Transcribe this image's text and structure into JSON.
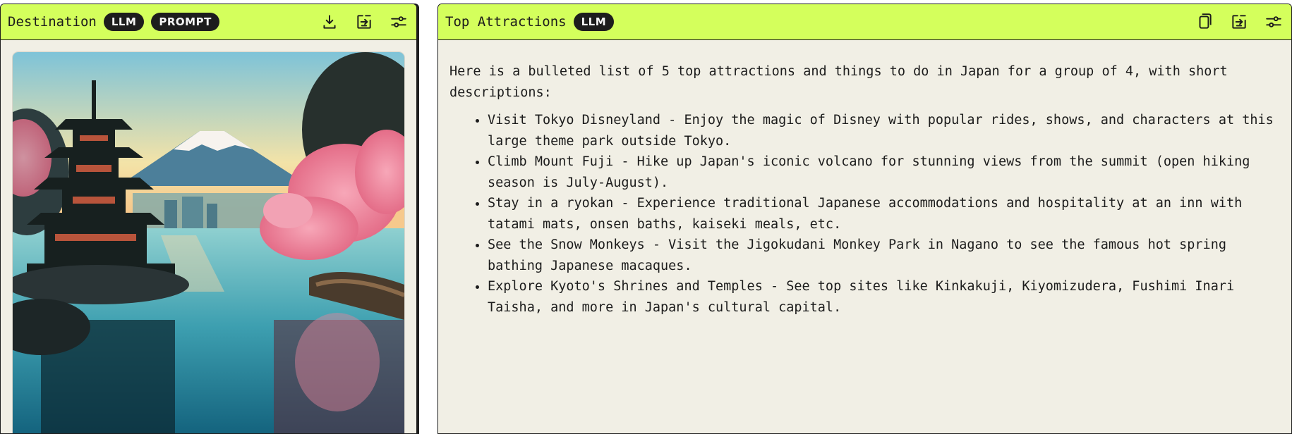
{
  "left_panel": {
    "title": "Destination",
    "badges": [
      "LLM",
      "PROMPT"
    ],
    "icons": [
      "download-icon",
      "share-export-icon",
      "settings-sliders-icon"
    ],
    "image_alt": "Pagoda by a lake with Mount Fuji and cherry blossoms"
  },
  "right_panel": {
    "title": "Top Attractions",
    "badges": [
      "LLM"
    ],
    "icons": [
      "copy-icon",
      "share-export-icon",
      "settings-sliders-icon"
    ],
    "intro": "Here is a bulleted list of 5 top attractions and things to do in Japan for a group of 4, with short descriptions:",
    "items": [
      "Visit Tokyo Disneyland - Enjoy the magic of Disney with popular rides, shows, and characters at this large theme park outside Tokyo.",
      "Climb Mount Fuji - Hike up Japan's iconic volcano for stunning views from the summit (open hiking season is July-August).",
      "Stay in a ryokan - Experience traditional Japanese accommodations and hospitality at an inn with tatami mats, onsen baths, kaiseki meals, etc.",
      "See the Snow Monkeys - Visit the Jigokudani Monkey Park in Nagano to see the famous hot spring bathing Japanese macaques.",
      "Explore Kyoto's Shrines and Temples - See top sites like Kinkakuji, Kiyomizudera, Fushimi Inari Taisha, and more in Japan's cultural capital."
    ]
  },
  "colors": {
    "header_bg": "#d4ff5c",
    "panel_bg": "#f1efe5",
    "badge_bg": "#1d1d1d",
    "text": "#1c1c1c"
  }
}
